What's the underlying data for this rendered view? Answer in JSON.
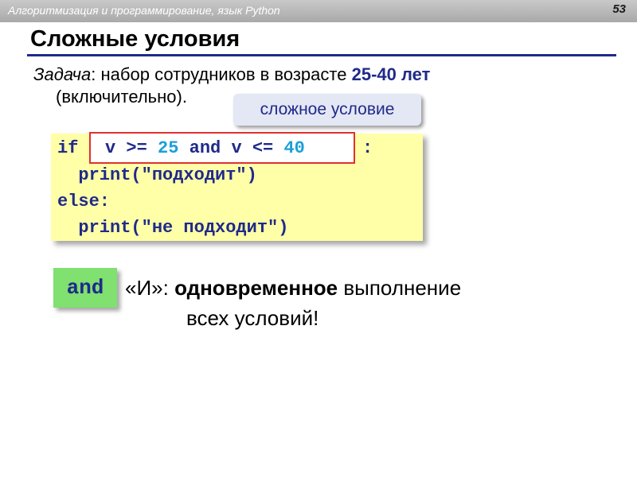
{
  "header": {
    "course": "Алгоритмизация и программирование, язык Python",
    "page_number": "53"
  },
  "title": "Сложные условия",
  "task": {
    "label": "Задача",
    "colon": ":",
    "text_before": " набор сотрудников в возрасте ",
    "highlight": "25-40 лет",
    "line2": "(включительно)."
  },
  "callout": "сложное условие",
  "code": {
    "if_kw": "if",
    "colon_after": ":",
    "condition": {
      "v1": "v",
      "ge": " >= ",
      "n1": "25",
      "and_kw": " and ",
      "v2": "v",
      "le": " <= ",
      "n2": "40"
    },
    "print1": "  print(\"подходит\")",
    "else_kw": "else:",
    "print2": "  print(\"не подходит\")"
  },
  "note": {
    "badge": "and",
    "quote": "«И»: ",
    "bold": "одновременное",
    "rest": " выполнение",
    "line2": "всех условий!"
  },
  "colors": {
    "accent": "#1f2a8a",
    "code_bg": "#ffffa8",
    "number": "#1aa0d8",
    "badge_bg": "#80e070",
    "border_red": "#e03030"
  }
}
